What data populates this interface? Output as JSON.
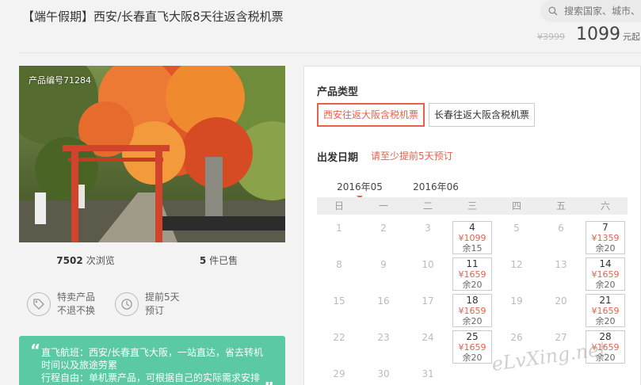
{
  "product": {
    "title": "【端午假期】西安/长春直飞大阪8天往返含税机票",
    "old_price": "¥3999",
    "price": "1099",
    "price_unit": "元起",
    "code": "产品编号71284"
  },
  "search": {
    "placeholder": "搜索国家、城市、"
  },
  "stats": {
    "views": "7502",
    "views_label": "次浏览",
    "sold": "5",
    "sold_label": "件已售"
  },
  "features": [
    {
      "line1": "特卖产品",
      "line2": "不退不换",
      "icon": "tag-icon"
    },
    {
      "line1": "提前5天",
      "line2": "预订",
      "icon": "clock-icon"
    }
  ],
  "quote": {
    "line1": "直飞航班：西安/长春直飞大阪，一站直达，省去转机",
    "line2": "时间以及旅途劳累",
    "line3": "行程自由：单机票产品，可根据自己的实际需求安排"
  },
  "booking": {
    "type_label": "产品类型",
    "options": [
      "西安往返大阪含税机票",
      "长春往返大阪含税机票"
    ],
    "date_label": "出发日期",
    "date_note": "请至少提前5天预订",
    "months": [
      "2016年05",
      "2016年06"
    ],
    "weekdays": [
      "日",
      "一",
      "二",
      "三",
      "四",
      "五",
      "六"
    ]
  },
  "calendar": [
    {
      "d": "1"
    },
    {
      "d": "2"
    },
    {
      "d": "3"
    },
    {
      "d": "4",
      "p": "¥1099",
      "s": "余15"
    },
    {
      "d": "5"
    },
    {
      "d": "6"
    },
    {
      "d": "7",
      "p": "¥1359",
      "s": "余20"
    },
    {
      "d": "8"
    },
    {
      "d": "9"
    },
    {
      "d": "10"
    },
    {
      "d": "11",
      "p": "¥1659",
      "s": "余20"
    },
    {
      "d": "12"
    },
    {
      "d": "13"
    },
    {
      "d": "14",
      "p": "¥1659",
      "s": "余20"
    },
    {
      "d": "15"
    },
    {
      "d": "16"
    },
    {
      "d": "17"
    },
    {
      "d": "18",
      "p": "¥1659",
      "s": "余20"
    },
    {
      "d": "19"
    },
    {
      "d": "20"
    },
    {
      "d": "21",
      "p": "¥1659",
      "s": "余20"
    },
    {
      "d": "22"
    },
    {
      "d": "23"
    },
    {
      "d": "24"
    },
    {
      "d": "25",
      "p": "¥1659",
      "s": "余20"
    },
    {
      "d": "26"
    },
    {
      "d": "27"
    },
    {
      "d": "28",
      "p": "¥1659",
      "s": "余20"
    },
    {
      "d": "29"
    },
    {
      "d": "30"
    },
    {
      "d": "31"
    }
  ],
  "watermark": "eLvXing.net",
  "colors": {
    "accent": "#e8604c",
    "quote_bg": "#5bc9a3"
  }
}
